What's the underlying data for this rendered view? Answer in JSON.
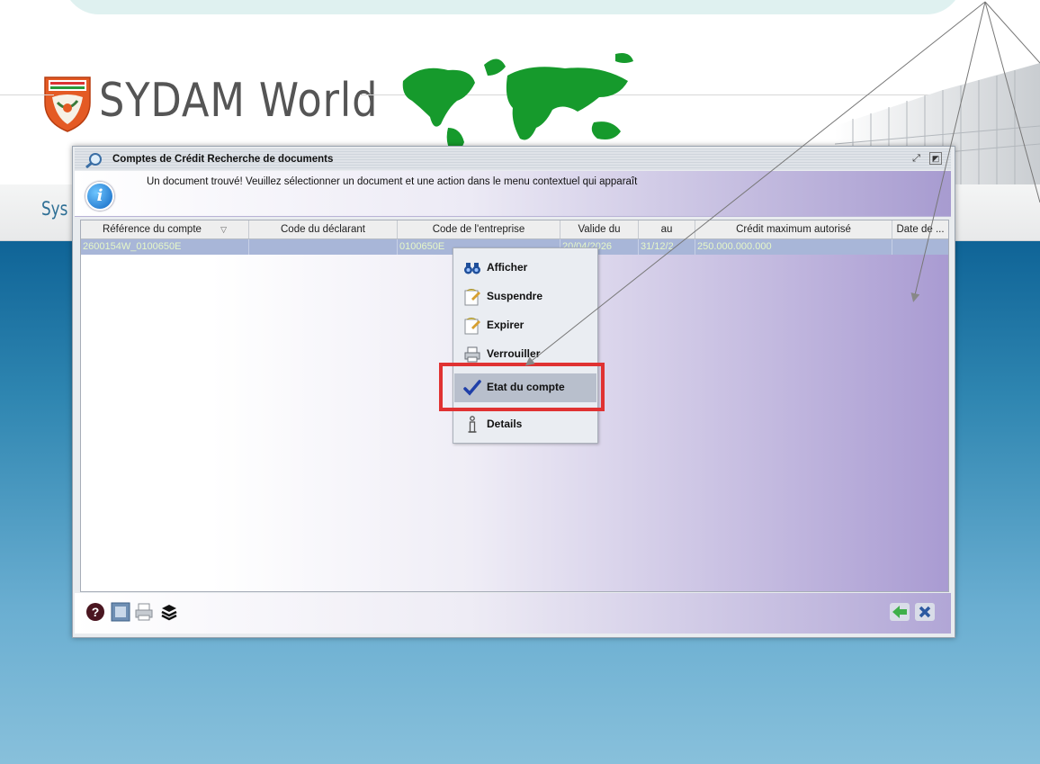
{
  "header": {
    "logo_badge_text": "DOUANES IVOIRIENNES",
    "app_title": "SYDAM World",
    "nav_prefix": "Sys"
  },
  "dialog": {
    "title": "Comptes de Crédit Recherche de documents",
    "info_message": "Un document trouvé! Veuillez sélectionner un document et une action dans le menu contextuel qui apparaît",
    "columns": [
      "Référence du compte",
      "Code du déclarant",
      "Code de l'entreprise",
      "Valide du",
      "au",
      "Crédit maximum autorisé",
      "Date de ..."
    ],
    "row": {
      "reference": "2600154W_0100650E",
      "declarant": "",
      "entreprise": "0100650E",
      "valide_du": "20/04/2026",
      "au": "31/12/2",
      "credit_max": "250.000.000.000",
      "date": ""
    }
  },
  "context_menu": {
    "items": [
      {
        "label": "Afficher",
        "icon": "binoculars-icon"
      },
      {
        "label": "Suspendre",
        "icon": "document-edit-icon"
      },
      {
        "label": "Expirer",
        "icon": "document-edit-icon"
      },
      {
        "label": "Verrouiller",
        "icon": "printer-icon"
      },
      {
        "label": "Etat du compte",
        "icon": "checkmark-icon"
      },
      {
        "label": "Details",
        "icon": "info-icon"
      }
    ],
    "selected_index": 4
  },
  "colors": {
    "highlight": "#e03232",
    "selected_row": "#a8b6d8",
    "row_text": "#e6f7c8",
    "blue_background": "#0f6497"
  }
}
